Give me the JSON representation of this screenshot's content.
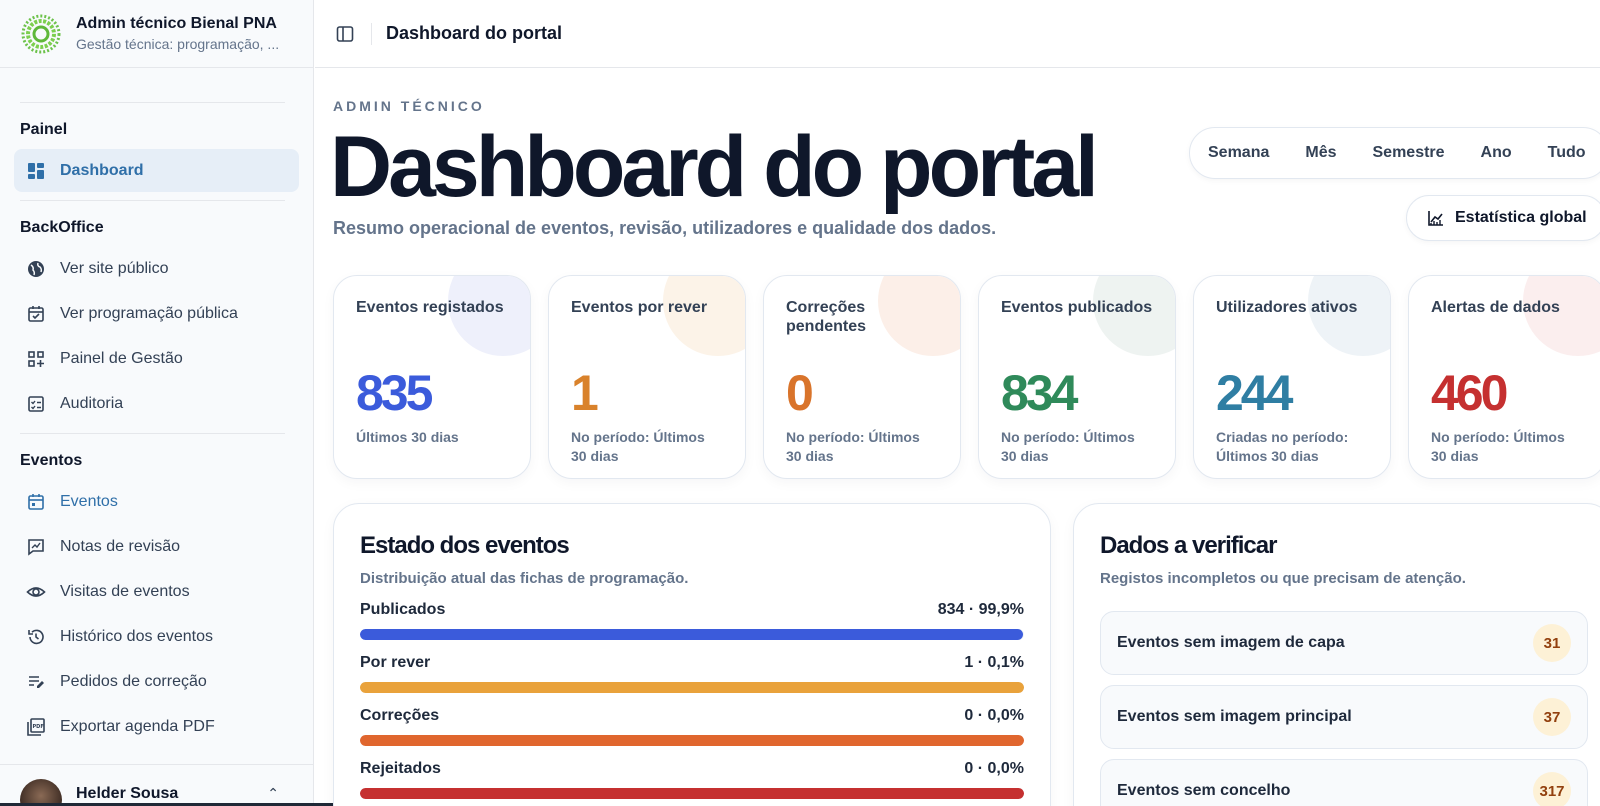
{
  "sidebar": {
    "brand_title": "Admin técnico Bienal PNA",
    "brand_sub": "Gestão técnica: programação, ...",
    "groups": [
      {
        "title": "Painel",
        "items": [
          {
            "label": "Dashboard",
            "icon": "dashboard-icon"
          }
        ]
      },
      {
        "title": "BackOffice",
        "items": [
          {
            "label": "Ver site público",
            "icon": "globe-icon"
          },
          {
            "label": "Ver programação pública",
            "icon": "calendar-check-icon"
          },
          {
            "label": "Painel de Gestão",
            "icon": "grid-plus-icon"
          },
          {
            "label": "Auditoria",
            "icon": "checklist-icon"
          }
        ]
      },
      {
        "title": "Eventos",
        "items": [
          {
            "label": "Eventos",
            "icon": "calendar-icon"
          },
          {
            "label": "Notas de revisão",
            "icon": "review-note-icon"
          },
          {
            "label": "Visitas de eventos",
            "icon": "eye-icon"
          },
          {
            "label": "Histórico dos eventos",
            "icon": "history-icon"
          },
          {
            "label": "Pedidos de correção",
            "icon": "edit-list-icon"
          },
          {
            "label": "Exportar agenda PDF",
            "icon": "pdf-icon"
          }
        ]
      }
    ],
    "user_name": "Helder Sousa"
  },
  "topbar": {
    "title": "Dashboard do portal"
  },
  "header": {
    "eyebrow": "ADMIN TÉCNICO",
    "title": "Dashboard do portal",
    "subtitle": "Resumo operacional de eventos, revisão, utilizadores e qualidade dos dados."
  },
  "period_filters": [
    "Semana",
    "Mês",
    "Semestre",
    "Ano",
    "Tudo"
  ],
  "global_button": "Estatística global",
  "stats": [
    {
      "label": "Eventos registados",
      "value": "835",
      "note": "Últimos 30 dias",
      "color": "#3b5bdb",
      "blob": "#eef0fb"
    },
    {
      "label": "Eventos por rever",
      "value": "1",
      "note": "No período: Últimos 30 dias",
      "color": "#d9822b",
      "blob": "#fcf3e8"
    },
    {
      "label": "Correções pendentes",
      "value": "0",
      "note": "No período: Últimos 30 dias",
      "color": "#d9742b",
      "blob": "#fcefe8"
    },
    {
      "label": "Eventos publicados",
      "value": "834",
      "note": "No período: Últimos 30 dias",
      "color": "#2f8a5a",
      "blob": "#eef3f1"
    },
    {
      "label": "Utilizadores ativos",
      "value": "244",
      "note": "Criadas no período: Últimos 30 dias",
      "color": "#2f7ea3",
      "blob": "#eef3f7"
    },
    {
      "label": "Alertas de dados",
      "value": "460",
      "note": "No período: Últimos 30 dias",
      "color": "#c53030",
      "blob": "#fbeeee"
    }
  ],
  "status_panel": {
    "title": "Estado dos eventos",
    "subtitle": "Distribuição atual das fichas de programação.",
    "rows": [
      {
        "label": "Publicados",
        "value": "834 · 99,9%",
        "fraction": 0.999,
        "color": "#3b5bdb"
      },
      {
        "label": "Por rever",
        "value": "1 · 0,1%",
        "fraction": 1.0,
        "color": "#e9a23b"
      },
      {
        "label": "Correções",
        "value": "0 · 0,0%",
        "fraction": 1.0,
        "color": "#e0662e"
      },
      {
        "label": "Rejeitados",
        "value": "0 · 0,0%",
        "fraction": 1.0,
        "color": "#c53030"
      }
    ]
  },
  "check_panel": {
    "title": "Dados a verificar",
    "subtitle": "Registos incompletos ou que precisam de atenção.",
    "items": [
      {
        "label": "Eventos sem imagem de capa",
        "count": "31"
      },
      {
        "label": "Eventos sem imagem principal",
        "count": "37"
      },
      {
        "label": "Eventos sem concelho",
        "count": "317"
      }
    ]
  }
}
